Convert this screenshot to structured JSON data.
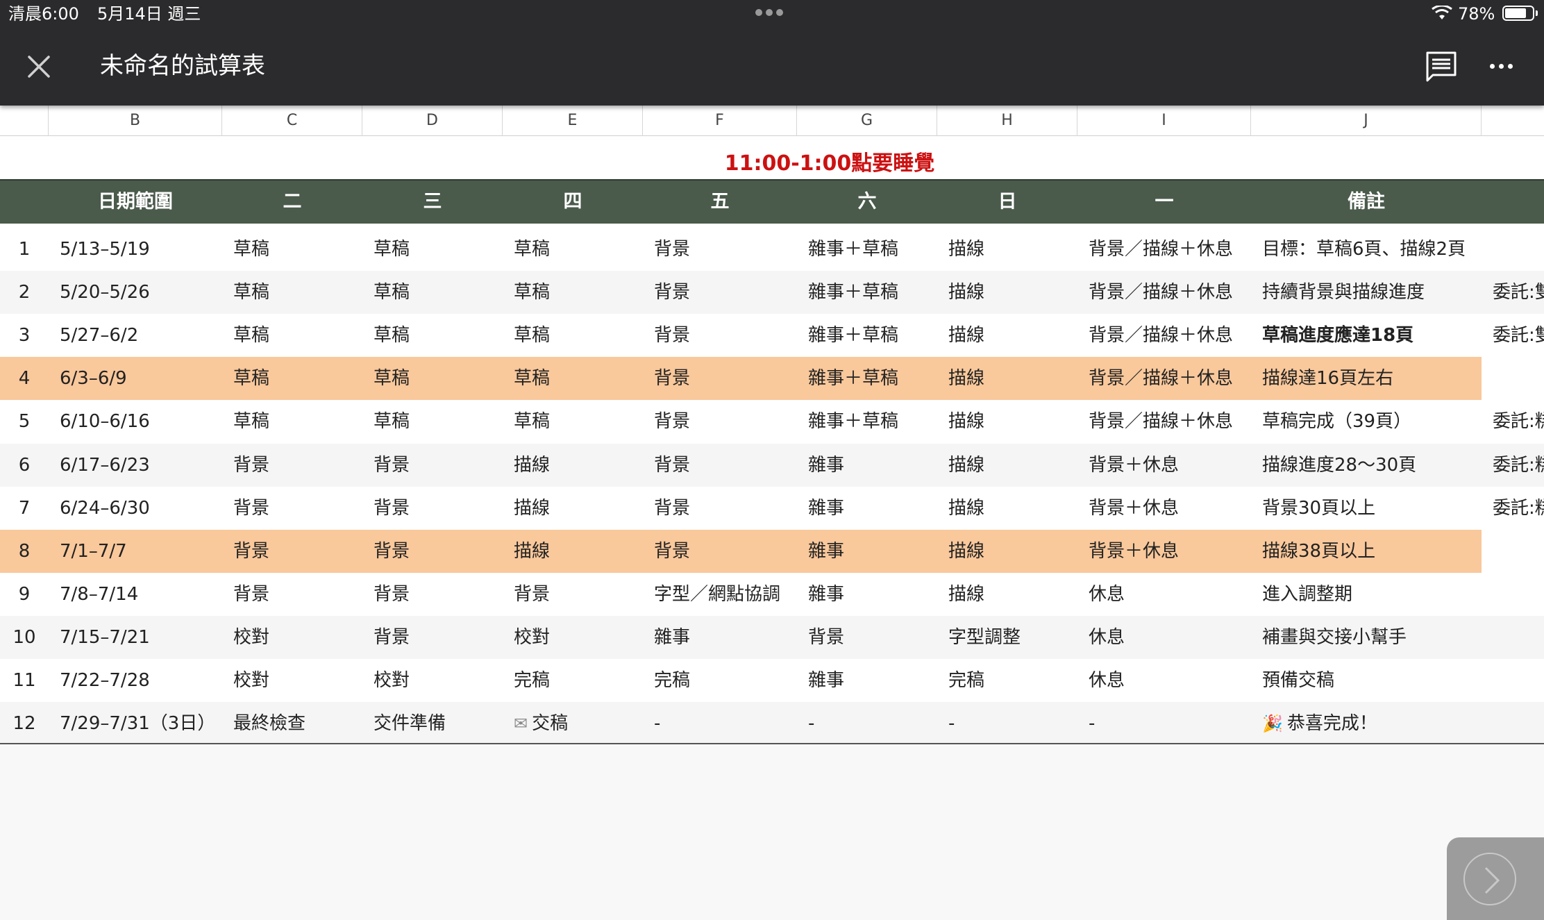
{
  "status_bar": {
    "time": "清晨6:00",
    "date": "5月14日 週三",
    "battery": "78%",
    "battery_level": 0.78
  },
  "toolbar": {
    "title": "未命名的試算表",
    "close_icon": "close-icon",
    "comment_icon": "comment-icon",
    "more_icon": "more-icon"
  },
  "column_headers": [
    "B",
    "C",
    "D",
    "E",
    "F",
    "G",
    "H",
    "I",
    "J"
  ],
  "sheet": {
    "banner": "11:00-1:00點要睡覺",
    "headers": [
      "日期範圍",
      "二",
      "三",
      "四",
      "五",
      "六",
      "日",
      "一",
      "備註"
    ],
    "rows": [
      {
        "n": "1",
        "date": "5/13–5/19",
        "c": [
          "草稿",
          "草稿",
          "草稿",
          "背景",
          "雜事＋草稿",
          "描線",
          "背景／描線＋休息",
          "目標：草稿6頁、描線2頁",
          ""
        ],
        "hl": false,
        "bold_note": false
      },
      {
        "n": "2",
        "date": "5/20–5/26",
        "c": [
          "草稿",
          "草稿",
          "草稿",
          "背景",
          "雜事＋草稿",
          "描線",
          "背景／描線＋休息",
          "持續背景與描線進度",
          "委託:雙"
        ],
        "hl": false,
        "bold_note": false
      },
      {
        "n": "3",
        "date": "5/27–6/2",
        "c": [
          "草稿",
          "草稿",
          "草稿",
          "背景",
          "雜事＋草稿",
          "描線",
          "背景／描線＋休息",
          "草稿進度應達18頁",
          "委託:雙"
        ],
        "hl": false,
        "bold_note": true
      },
      {
        "n": "4",
        "date": "6/3–6/9",
        "c": [
          "草稿",
          "草稿",
          "草稿",
          "背景",
          "雜事＋草稿",
          "描線",
          "背景／描線＋休息",
          "描線達16頁左右",
          ""
        ],
        "hl": true,
        "bold_note": false
      },
      {
        "n": "5",
        "date": "6/10–6/16",
        "c": [
          "草稿",
          "草稿",
          "草稿",
          "背景",
          "雜事＋草稿",
          "描線",
          "背景／描線＋休息",
          "草稿完成（39頁）",
          "委託:糕"
        ],
        "hl": false,
        "bold_note": false
      },
      {
        "n": "6",
        "date": "6/17–6/23",
        "c": [
          "背景",
          "背景",
          "描線",
          "背景",
          "雜事",
          "描線",
          "背景＋休息",
          "描線進度28～30頁",
          "委託:糕"
        ],
        "hl": false,
        "bold_note": false
      },
      {
        "n": "7",
        "date": "6/24–6/30",
        "c": [
          "背景",
          "背景",
          "描線",
          "背景",
          "雜事",
          "描線",
          "背景＋休息",
          "背景30頁以上",
          "委託:糕"
        ],
        "hl": false,
        "bold_note": false
      },
      {
        "n": "8",
        "date": "7/1–7/7",
        "c": [
          "背景",
          "背景",
          "描線",
          "背景",
          "雜事",
          "描線",
          "背景＋休息",
          "描線38頁以上",
          ""
        ],
        "hl": true,
        "bold_note": false
      },
      {
        "n": "9",
        "date": "7/8–7/14",
        "c": [
          "背景",
          "背景",
          "背景",
          "字型／網點協調",
          "雜事",
          "描線",
          "休息",
          "進入調整期",
          ""
        ],
        "hl": false,
        "bold_note": false
      },
      {
        "n": "10",
        "date": "7/15–7/21",
        "c": [
          "校對",
          "背景",
          "校對",
          "雜事",
          "背景",
          "字型調整",
          "休息",
          "補畫與交接小幫手",
          ""
        ],
        "hl": false,
        "bold_note": false
      },
      {
        "n": "11",
        "date": "7/22–7/28",
        "c": [
          "校對",
          "校對",
          "完稿",
          "完稿",
          "雜事",
          "完稿",
          "休息",
          "預備交稿",
          ""
        ],
        "hl": false,
        "bold_note": false
      },
      {
        "n": "12",
        "date": "7/29–7/31（3日）",
        "c": [
          "最終檢查",
          "交件準備",
          "交稿",
          "-",
          "-",
          "-",
          "-",
          "恭喜完成！",
          ""
        ],
        "hl": false,
        "bold_note": false,
        "emoji_e": "✉",
        "emoji_j": "🎉"
      }
    ]
  },
  "colors": {
    "toolbar_bg": "#2b2b2d",
    "header_bg": "#4a5a4b",
    "highlight": "#f9c89b",
    "banner_text": "#cc1111"
  }
}
